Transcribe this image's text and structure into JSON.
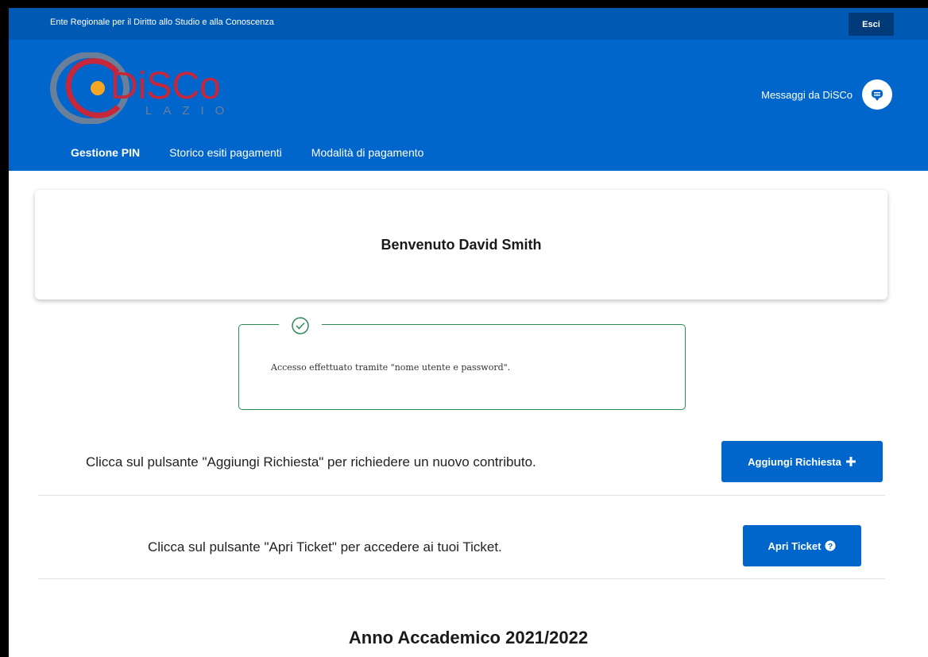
{
  "topbar": {
    "ente_label": "Ente Regionale per il Diritto allo Studio e alla Conoscenza",
    "esci_label": "Esci"
  },
  "header": {
    "logo_text": "DiSCo",
    "logo_subtext": "LAZIO",
    "messages_label": "Messaggi da DiSCo"
  },
  "nav": {
    "items": [
      {
        "label": "Gestione PIN"
      },
      {
        "label": "Storico esiti pagamenti"
      },
      {
        "label": "Modalità di pagamento"
      }
    ]
  },
  "welcome": {
    "title": "Benvenuto David Smith"
  },
  "notice": {
    "text": "Accesso effettuato tramite \"nome utente e password\"."
  },
  "actions": {
    "richiesta_text": "Clicca sul pulsante \"Aggiungi Richiesta\" per richiedere un nuovo contributo.",
    "richiesta_button": "Aggiungi Richiesta",
    "ticket_text": "Clicca sul pulsante \"Apri Ticket\" per accedere ai tuoi Ticket.",
    "ticket_button": "Apri Ticket"
  },
  "section": {
    "year_title": "Anno Accademico 2021/2022"
  },
  "colors": {
    "primary": "#0066cc",
    "topbar": "#0059b3",
    "success": "#2e8b57"
  }
}
